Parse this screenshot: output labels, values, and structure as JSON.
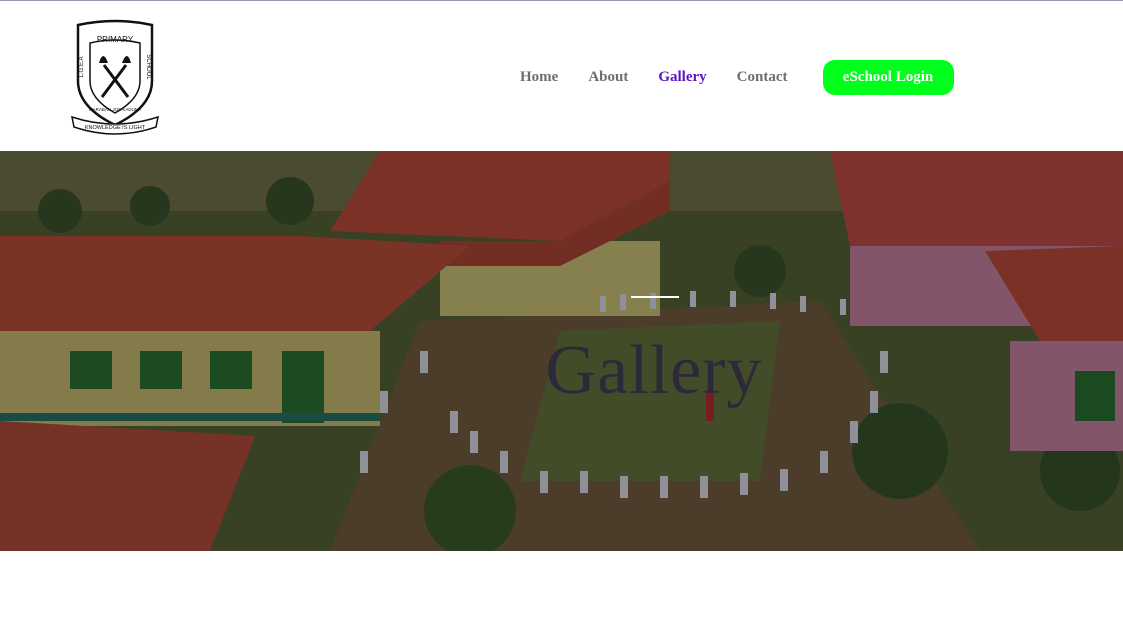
{
  "logo": {
    "top_text": "PRIMARY",
    "left_text": "L.G.E.A",
    "right_text": "SCHOOL",
    "bottom_text": "MARABAN JOS KADUNA",
    "motto": "KNOWLEDGE IS LIGHT"
  },
  "nav": {
    "items": [
      {
        "label": "Home",
        "active": false
      },
      {
        "label": "About",
        "active": false
      },
      {
        "label": "Gallery",
        "active": true
      },
      {
        "label": "Contact",
        "active": false
      }
    ],
    "login_label": "eSchool Login"
  },
  "hero": {
    "title": "Gallery",
    "image_icon": "school-campus-photo"
  },
  "colors": {
    "accent": "#5b14c4",
    "login_bg": "#00ff1a",
    "nav_text": "#6f6f6f"
  }
}
